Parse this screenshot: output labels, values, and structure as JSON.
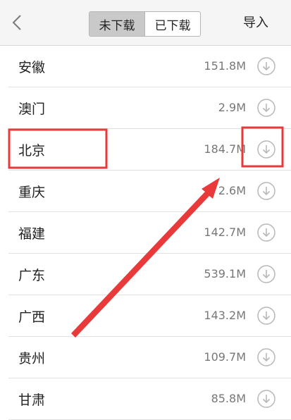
{
  "header": {
    "tabs": [
      "未下载",
      "已下载"
    ],
    "active_tab": 0,
    "import_label": "导入"
  },
  "list": [
    {
      "name": "安徽",
      "size": "151.8M"
    },
    {
      "name": "澳门",
      "size": "2.9M"
    },
    {
      "name": "北京",
      "size": "184.7M"
    },
    {
      "name": "重庆",
      "size": "2.6M"
    },
    {
      "name": "福建",
      "size": "142.7M"
    },
    {
      "name": "广东",
      "size": "539.1M"
    },
    {
      "name": "广西",
      "size": "143.2M"
    },
    {
      "name": "贵州",
      "size": "109.7M"
    },
    {
      "name": "甘肃",
      "size": "85.8M"
    }
  ],
  "colors": {
    "header_bg": "#f5f5f5",
    "active_tab_bg": "#c9c9c9",
    "annotation": "#e83a3a",
    "icon": "#b8b8b8"
  },
  "icons": {
    "back": "chevron-left-icon",
    "download": "download-circle-icon"
  }
}
